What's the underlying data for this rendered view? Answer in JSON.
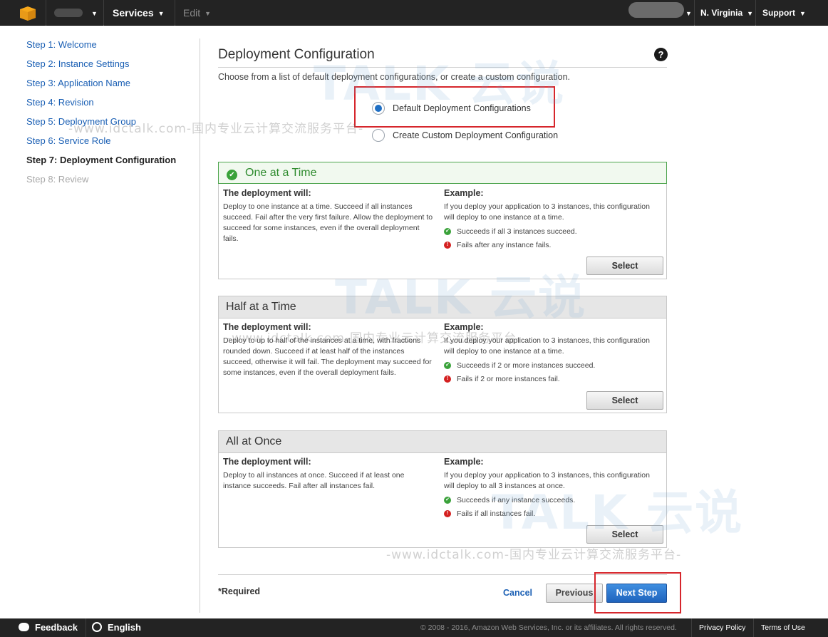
{
  "topbar": {
    "services_label": "Services",
    "edit_label": "Edit",
    "region_label": "N. Virginia",
    "support_label": "Support"
  },
  "sidebar": {
    "steps": [
      {
        "label": "Step 1: Welcome",
        "state": "link"
      },
      {
        "label": "Step 2: Instance Settings",
        "state": "link"
      },
      {
        "label": "Step 3: Application Name",
        "state": "link"
      },
      {
        "label": "Step 4: Revision",
        "state": "link"
      },
      {
        "label": "Step 5: Deployment Group",
        "state": "link"
      },
      {
        "label": "Step 6: Service Role",
        "state": "link"
      },
      {
        "label": "Step 7: Deployment Configuration",
        "state": "current"
      },
      {
        "label": "Step 8: Review",
        "state": "disabled"
      }
    ]
  },
  "main": {
    "title": "Deployment Configuration",
    "help_icon": "?",
    "intro": "Choose from a list of default deployment configurations, or create a custom configuration.",
    "options": {
      "default_label": "Default Deployment Configurations",
      "custom_label": "Create Custom Deployment Configuration",
      "selected": "default"
    },
    "cards": [
      {
        "title": "One at a Time",
        "selected": true,
        "left_heading": "The deployment will:",
        "left_text": "Deploy to one instance at a time. Succeed if all instances succeed. Fail after the very first failure. Allow the deployment to succeed for some instances, even if the overall deployment fails.",
        "right_heading": "Example:",
        "right_text": "If you deploy your application to 3 instances, this configuration will deploy to one instance at a time.",
        "success": "Succeeds if all 3 instances succeed.",
        "failure": "Fails after any instance fails.",
        "button": "Select"
      },
      {
        "title": "Half at a Time",
        "selected": false,
        "left_heading": "The deployment will:",
        "left_text": "Deploy to up to half of the instances at a time, with fractions rounded down. Succeed if at least half of the instances succeed, otherwise it will fail. The deployment may succeed for some instances, even if the overall deployment fails.",
        "right_heading": "Example:",
        "right_text": "If you deploy your application to 3 instances, this configuration will deploy to one instance at a time.",
        "success": "Succeeds if 2 or more instances succeed.",
        "failure": "Fails if 2 or more instances fail.",
        "button": "Select"
      },
      {
        "title": "All at Once",
        "selected": false,
        "left_heading": "The deployment will:",
        "left_text": "Deploy to all instances at once. Succeed if at least one instance succeeds. Fail after all instances fail.",
        "right_heading": "Example:",
        "right_text": "If you deploy your application to 3 instances, this configuration will deploy to all 3 instances at once.",
        "success": "Succeeds if any instance succeeds.",
        "failure": "Fails if all instances fail.",
        "button": "Select"
      }
    ],
    "required_note": "*Required",
    "cancel_label": "Cancel",
    "previous_label": "Previous",
    "next_label": "Next Step"
  },
  "footer": {
    "feedback_label": "Feedback",
    "language_label": "English",
    "copyright": "© 2008 - 2016, Amazon Web Services, Inc. or its affiliates. All rights reserved.",
    "privacy_label": "Privacy Policy",
    "terms_label": "Terms of Use"
  },
  "watermark": {
    "big_text": "TALK 云说",
    "small_text": "-www.idctalk.com-国内专业云计算交流服务平台-"
  },
  "colors": {
    "topbar_bg": "#232323",
    "link_blue": "#1a5fb4",
    "primary_button": "#1f64bd",
    "selected_green": "#3aa23a",
    "highlight_red": "#d6262c"
  }
}
